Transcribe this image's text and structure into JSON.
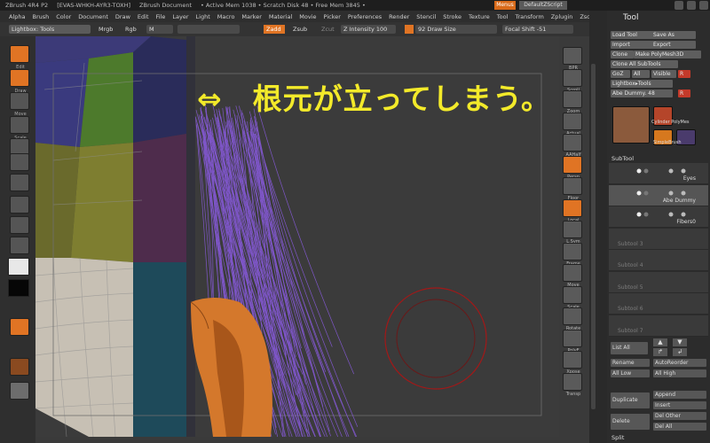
{
  "titlebar": {
    "app": "ZBrush 4R4 P2",
    "serial": "[EVAS-WHKH-AYR3-TOXH]",
    "doc": "ZBrush Document",
    "status": "• Active Mem 1038 • Scratch Disk 48 • Free Mem 3845 •",
    "menus_btn": "Menus",
    "script_btn": "DefaultZScript"
  },
  "menubar": [
    "Alpha",
    "Brush",
    "Color",
    "Document",
    "Draw",
    "Edit",
    "File",
    "Layer",
    "Light",
    "Macro",
    "Marker",
    "Material",
    "Movie",
    "Picker",
    "Preferences",
    "Render",
    "Stencil",
    "Stroke",
    "Texture",
    "Tool",
    "Transform",
    "Zplugin",
    "Zscript"
  ],
  "topbar": {
    "lightbox": "Lightbox: Tools",
    "mrgb": "Mrgb",
    "rgb": "Rgb",
    "m": "M",
    "zadd": "Zadd",
    "zsub": "Zsub",
    "zcut": "Zcut",
    "z_intensity_label": "Z Intensity",
    "z_intensity_value": "100",
    "draw_size_value": "92",
    "draw_size_label": "Draw Size",
    "focal_label": "Focal Shift",
    "focal_value": "-51"
  },
  "caption": "⇔　根元が立ってしまう。",
  "left_tools": [
    {
      "label": "Edit",
      "orange": true
    },
    {
      "label": "Draw",
      "orange": true
    },
    {
      "label": "Move",
      "orange": false
    },
    {
      "label": "Scale",
      "orange": false
    },
    {
      "label": "Rotate",
      "orange": false
    },
    {
      "label": "",
      "orange": false
    },
    {
      "label": "",
      "orange": false
    },
    {
      "label": "",
      "orange": false
    },
    {
      "label": "",
      "orange": false
    },
    {
      "label": "",
      "orange": false
    }
  ],
  "right_tools": [
    {
      "label": "BPR",
      "orange": false
    },
    {
      "label": "Scroll",
      "orange": false
    },
    {
      "label": "Zoom",
      "orange": false
    },
    {
      "label": "Actual",
      "orange": false
    },
    {
      "label": "AAHalf",
      "orange": false
    },
    {
      "label": "Persp",
      "orange": true
    },
    {
      "label": "Floor",
      "orange": false
    },
    {
      "label": "Local",
      "orange": true
    },
    {
      "label": "L.Sym",
      "orange": false
    },
    {
      "label": "Frame",
      "orange": false
    },
    {
      "label": "Move",
      "orange": false
    },
    {
      "label": "Scale",
      "orange": false
    },
    {
      "label": "Rotate",
      "orange": false
    },
    {
      "label": "PolyF",
      "orange": false
    },
    {
      "label": "Xpose",
      "orange": false
    },
    {
      "label": "Transp",
      "orange": false
    }
  ],
  "tool_panel": {
    "title": "Tool",
    "buttons": [
      [
        "Load Tool",
        "Save As"
      ],
      [
        "Import",
        "Export"
      ],
      [
        "Clone",
        "Make PolyMesh3D"
      ],
      [
        "Clone All SubTools",
        ""
      ],
      [
        "GoZ",
        "All",
        "Visible",
        "R"
      ],
      [
        "Lightbox▸Tools",
        ""
      ],
      [
        "Abe Dummy. 48",
        "R"
      ]
    ],
    "thumb_labels": [
      "Cylinder PolyMes",
      "SimpleBrush"
    ],
    "subtool_header": "SubTool",
    "subtools": [
      "Eyes",
      "Abe Dummy",
      "Fibers0",
      "Subtool 3",
      "Subtool 4",
      "Subtool 5",
      "Subtool 6",
      "Subtool 7"
    ],
    "list_all": "List All",
    "rename": "Rename",
    "autoreorder": "AutoReorder",
    "all_low": "All Low",
    "all_high": "All High",
    "duplicate": "Duplicate",
    "append": "Append",
    "insert": "Insert",
    "delete": "Delete",
    "del_other": "Del Other",
    "del_all": "Del All",
    "split": "Split"
  }
}
